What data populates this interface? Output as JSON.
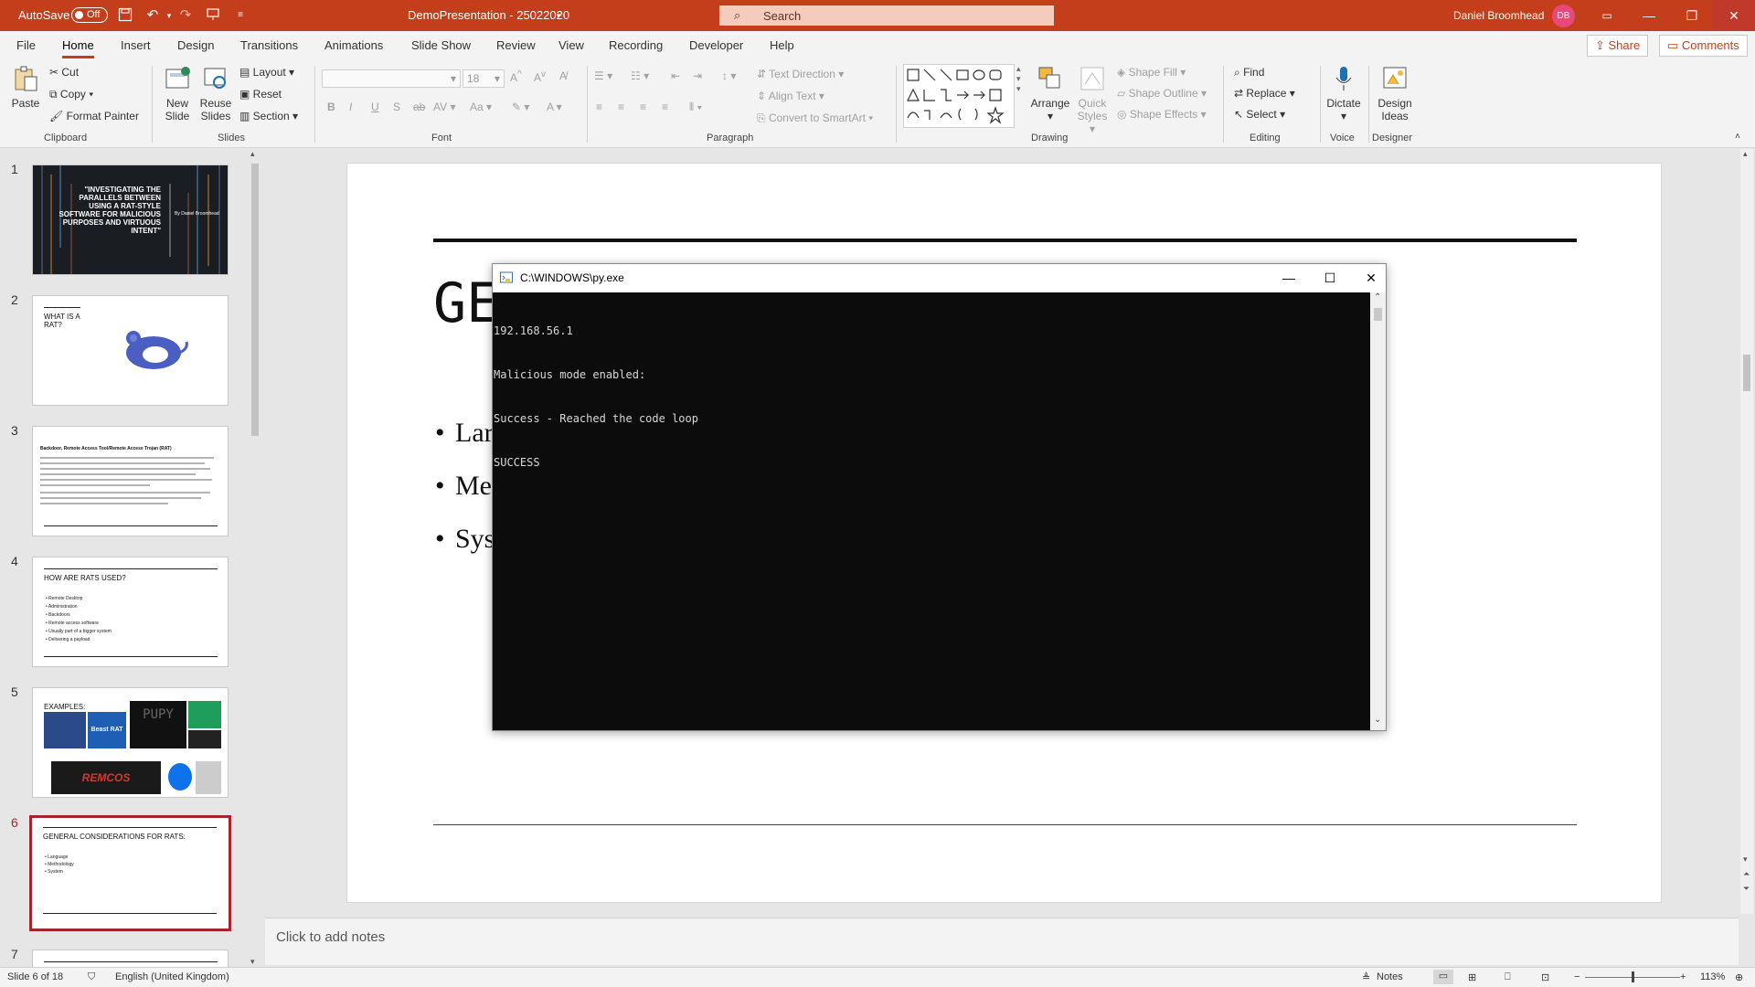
{
  "titlebar": {
    "autosave_label": "AutoSave",
    "autosave_state": "Off",
    "document_title": "DemoPresentation - 25022020",
    "search_placeholder": "Search",
    "user_name": "Daniel Broomhead",
    "user_initials": "DB"
  },
  "menu": {
    "tabs": [
      "File",
      "Home",
      "Insert",
      "Design",
      "Transitions",
      "Animations",
      "Slide Show",
      "Review",
      "View",
      "Recording",
      "Developer",
      "Help"
    ],
    "active_tab": "Home",
    "share_label": "Share",
    "comments_label": "Comments"
  },
  "ribbon": {
    "clipboard": {
      "paste": "Paste",
      "cut": "Cut",
      "copy": "Copy",
      "format_painter": "Format Painter",
      "label": "Clipboard"
    },
    "slides": {
      "new_slide_1": "New",
      "new_slide_2": "Slide",
      "reuse_1": "Reuse",
      "reuse_2": "Slides",
      "layout": "Layout",
      "reset": "Reset",
      "section": "Section",
      "label": "Slides"
    },
    "font": {
      "size": "18",
      "label": "Font"
    },
    "paragraph": {
      "text_direction": "Text Direction",
      "align_text": "Align Text",
      "convert_smartart": "Convert to SmartArt",
      "label": "Paragraph"
    },
    "drawing": {
      "arrange": "Arrange",
      "quick_styles_1": "Quick",
      "quick_styles_2": "Styles",
      "shape_fill": "Shape Fill",
      "shape_outline": "Shape Outline",
      "shape_effects": "Shape Effects",
      "label": "Drawing"
    },
    "editing": {
      "find": "Find",
      "replace": "Replace",
      "select": "Select",
      "label": "Editing"
    },
    "voice": {
      "dictate": "Dictate",
      "label": "Voice"
    },
    "designer": {
      "design_ideas_1": "Design",
      "design_ideas_2": "Ideas",
      "label": "Designer"
    }
  },
  "thumbnails": [
    {
      "num": "1",
      "title": "\"INVESTIGATING THE PARALLELS BETWEEN USING A RAT-STYLE SOFTWARE FOR MALICIOUS PURPOSES AND VIRTUOUS INTENT\"",
      "byline": "By Daniel Broomhead"
    },
    {
      "num": "2",
      "title": "WHAT IS A RAT?"
    },
    {
      "num": "3",
      "title": "Backdoor, Remote Access Tool/Remote Access Trojan (RAT)"
    },
    {
      "num": "4",
      "title": "HOW ARE RATS USED?",
      "bullets": [
        "Remote Desktop",
        "Administration",
        "Backdoors",
        "Remote access software",
        "Usually part of a bigger system",
        "Delivering a payload"
      ]
    },
    {
      "num": "5",
      "title": "EXAMPLES:",
      "labels": [
        "Beast RAT",
        "PUPY",
        "REMCOS"
      ]
    },
    {
      "num": "6",
      "title": "GENERAL CONSIDERATIONS FOR RATS:",
      "bullets": [
        "Language",
        "Methodology",
        "System"
      ]
    },
    {
      "num": "7"
    }
  ],
  "slide": {
    "title_visible": "GE",
    "bullets_visible": [
      "Lar",
      "Me",
      "Sys"
    ]
  },
  "console": {
    "title": "C:\\WINDOWS\\py.exe",
    "lines": [
      "192.168.56.1",
      "Malicious mode enabled:",
      "Success - Reached the code loop",
      "SUCCESS"
    ]
  },
  "notes": {
    "placeholder": "Click to add notes"
  },
  "statusbar": {
    "slide_info": "Slide 6 of 18",
    "language": "English (United Kingdom)",
    "notes": "Notes",
    "zoom": "113%"
  },
  "colors": {
    "accent": "#c43e1c",
    "selection": "#a4262c"
  }
}
